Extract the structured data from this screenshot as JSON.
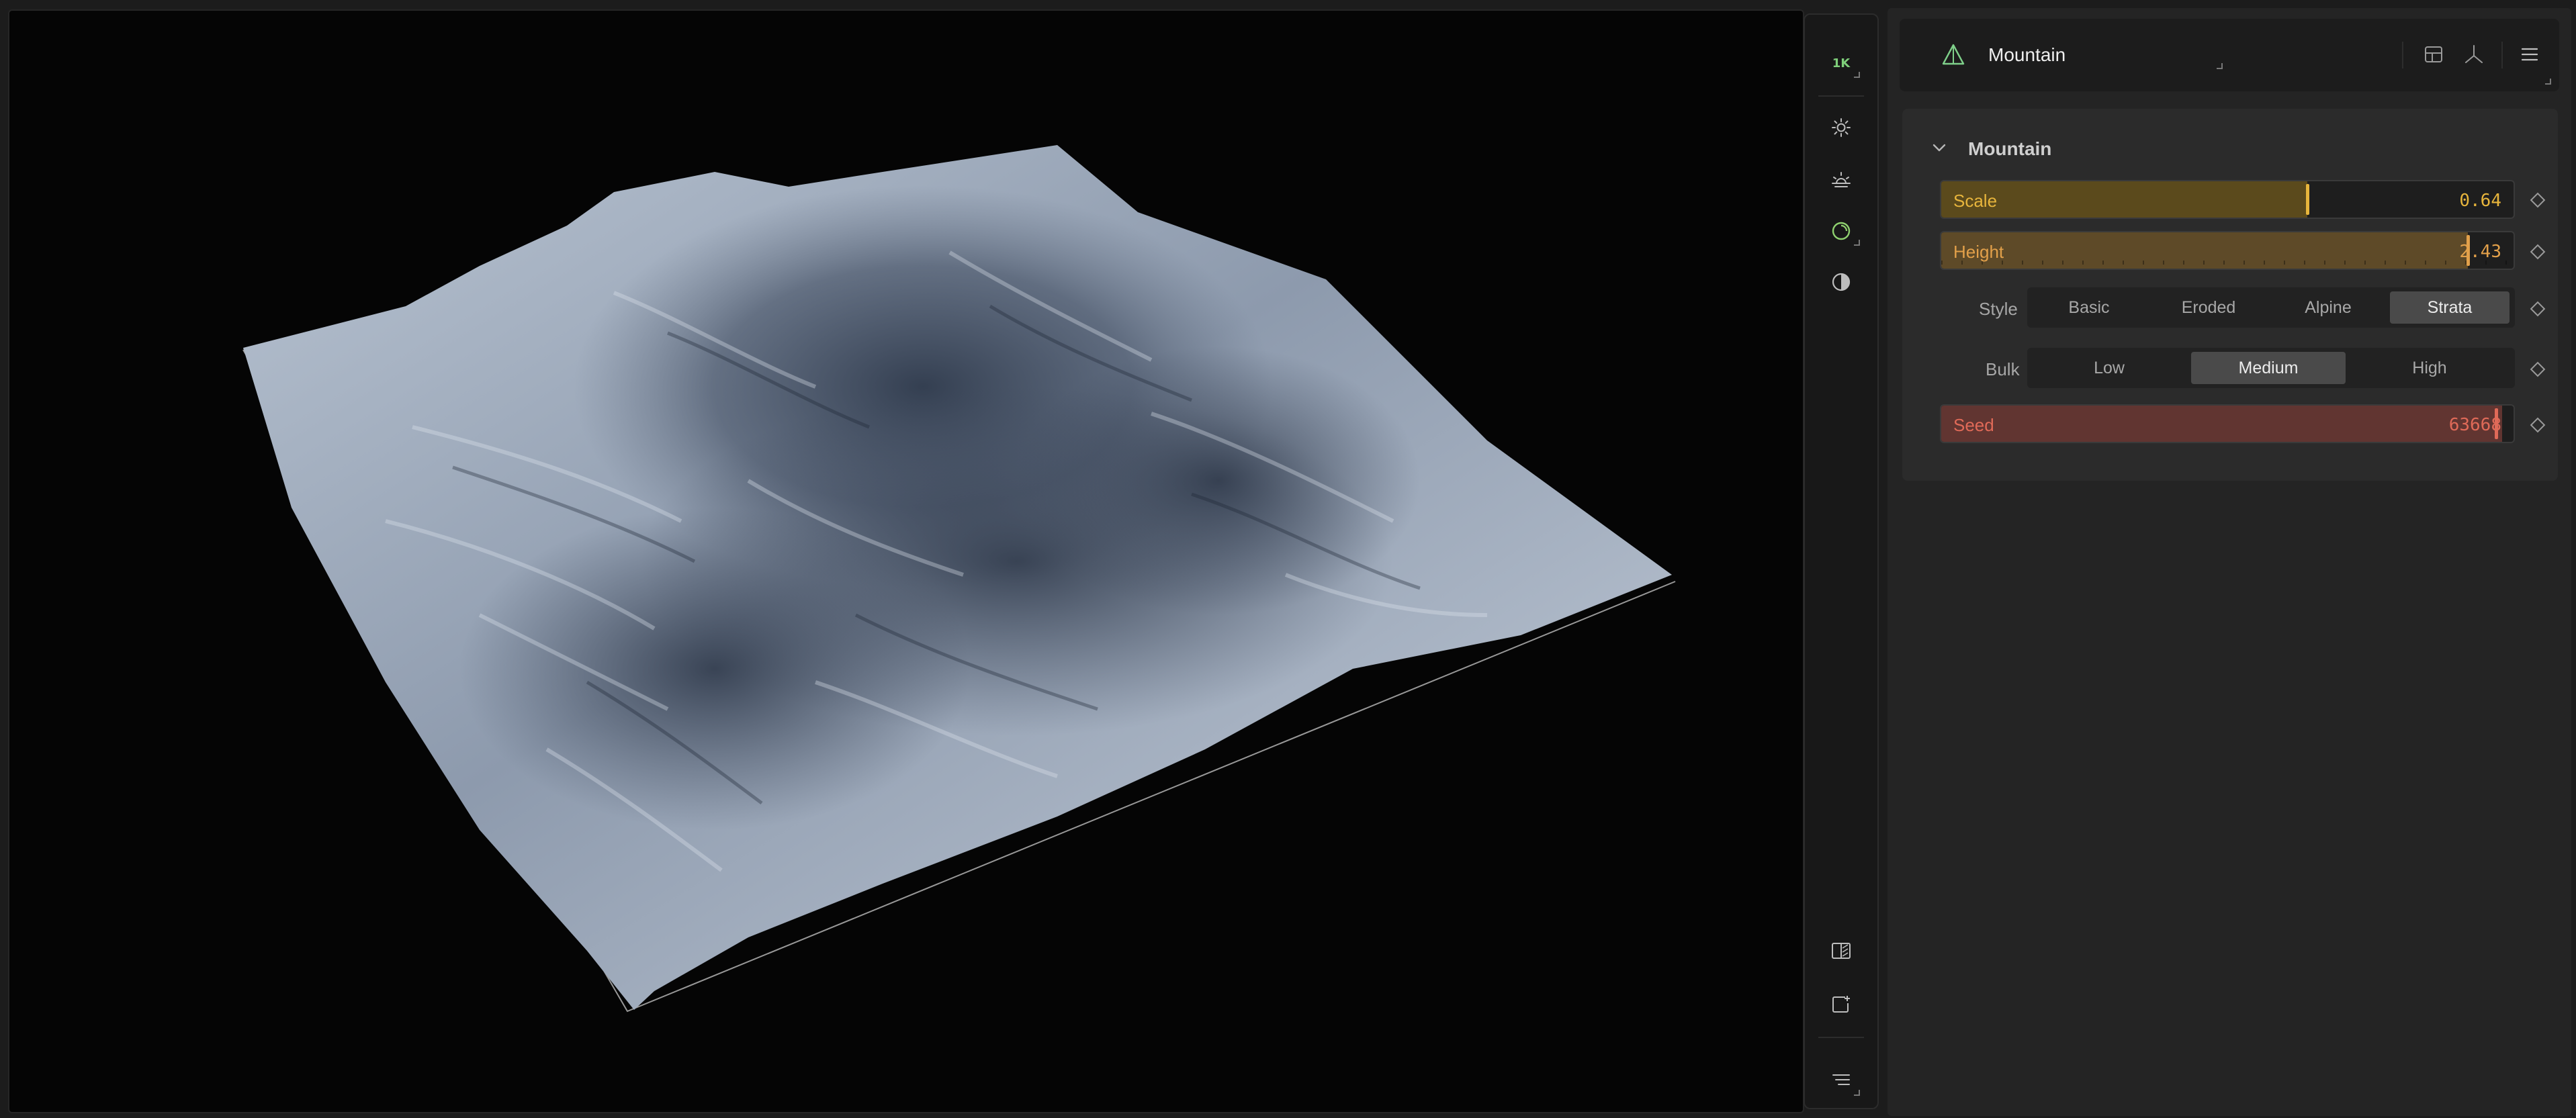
{
  "viewport": {
    "name": "3d-terrain-preview",
    "background": "#050505"
  },
  "toolbar": {
    "resolution_label": "1K",
    "icons": [
      "sun-icon",
      "sunrise-icon",
      "material-sphere-icon",
      "contrast-icon",
      "split-view-icon",
      "add-view-icon",
      "menu-lines-icon"
    ]
  },
  "panel": {
    "header": {
      "node_title": "Mountain",
      "node_icon": "mountain-icon",
      "right_icons": [
        "table-icon",
        "axes-icon",
        "menu-icon"
      ]
    },
    "section": {
      "title": "Mountain",
      "params": {
        "scale": {
          "label": "Scale",
          "value": "0.64",
          "fraction": 0.64,
          "color": "#e7b53c"
        },
        "height": {
          "label": "Height",
          "value": "2.43",
          "fraction": 0.97,
          "color": "#e2a04a"
        },
        "style": {
          "label": "Style",
          "options": [
            "Basic",
            "Eroded",
            "Alpine",
            "Strata"
          ],
          "selected": "Strata"
        },
        "bulk": {
          "label": "Bulk",
          "options": [
            "Low",
            "Medium",
            "High"
          ],
          "selected": "Medium"
        },
        "seed": {
          "label": "Seed",
          "value": "63668",
          "fraction": 0.98,
          "color": "#e06a58"
        }
      }
    }
  }
}
